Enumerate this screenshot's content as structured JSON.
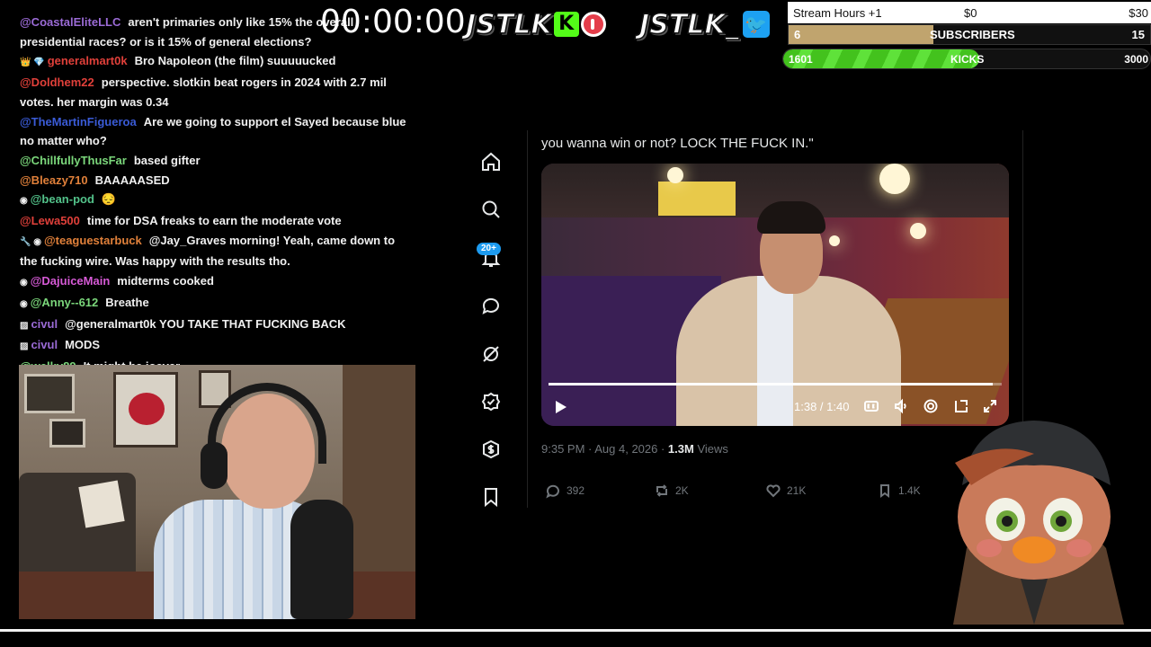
{
  "chat": [
    {
      "badge": "",
      "user": "@CoastalEliteLLC",
      "color": "#9b6bd6",
      "text": "aren't primaries only like 15% the overall presidential races? or is it 15% of general elections?"
    },
    {
      "badge": "👑 💎",
      "user": "generalmart0k",
      "color": "#e0403a",
      "text": "Bro Napoleon (the film) suuuuucked"
    },
    {
      "badge": "",
      "user": "@Doldhem22",
      "color": "#e0403a",
      "text": "perspective. slotkin beat rogers in 2024 with 2.7 mil votes. her margin was 0.34"
    },
    {
      "badge": "",
      "user": "@TheMartinFigueroa",
      "color": "#3a5bd6",
      "text": "Are we going to support el Sayed because blue no matter who?"
    },
    {
      "badge": "",
      "user": "@ChillfullyThusFar",
      "color": "#7bd77b",
      "text": "based gifter"
    },
    {
      "badge": "",
      "user": "@Bleazy710",
      "color": "#e0803a",
      "text": "BAAAAASED"
    },
    {
      "badge": "◉",
      "user": "@bean-pod",
      "color": "#53c28a",
      "text": "😔"
    },
    {
      "badge": "",
      "user": "@Lewa500",
      "color": "#e0403a",
      "text": "time for DSA freaks to earn the moderate vote"
    },
    {
      "badge": "🔧 ◉",
      "user": "@teaguestarbuck",
      "color": "#e0803a",
      "text": "@Jay_Graves morning! Yeah, came down to the fucking wire. Was happy with the results tho."
    },
    {
      "badge": "◉",
      "user": "@DajuiceMain",
      "color": "#d65ad6",
      "text": "midterms cooked"
    },
    {
      "badge": "◉",
      "user": "@Anny--612",
      "color": "#7bd77b",
      "text": "Breathe"
    },
    {
      "badge": "▨",
      "user": "civul",
      "color": "#9b6bd6",
      "text": "@generalmart0k YOU TAKE THAT FUCKING BACK"
    },
    {
      "badge": "▨",
      "user": "civul",
      "color": "#9b6bd6",
      "text": "MODS"
    },
    {
      "badge": "",
      "user": "@welky89",
      "color": "#7bd77b",
      "text": "It might be joever"
    }
  ],
  "timer": "00:00:00",
  "logos": {
    "kick": "JSTLK",
    "twitter": "JSTLK_"
  },
  "goals": {
    "hours": {
      "label": "Stream Hours +1",
      "min": "$0",
      "max": "$30"
    },
    "subs": {
      "current": "6",
      "label": "SUBSCRIBERS",
      "max": "15",
      "fraction": 0.4
    },
    "kicks": {
      "current": "1601",
      "label": "KICKS",
      "max": "3000",
      "fraction": 0.5337
    }
  },
  "nav": {
    "icons": [
      "home-icon",
      "search-icon",
      "notifications-icon",
      "messages-icon",
      "grok-icon",
      "verified-icon",
      "monetization-icon",
      "bookmarks-icon"
    ],
    "notif_badge": "20+"
  },
  "tweet": {
    "text": "you wanna win or not? LOCK THE FUCK IN.\"",
    "video_time": "1:38 / 1:40",
    "video_progress": 0.98,
    "meta_time": "9:35 PM · Aug 4, 2026 · ",
    "views_count": "1.3M",
    "views_label": " Views",
    "replies": "392",
    "reposts": "2K",
    "likes": "21K",
    "bookmarks": "1.4K"
  },
  "colors": {
    "accent": "#1d9bf0",
    "kick_green": "#53fc18",
    "subs_bar": "#c0a46e"
  }
}
